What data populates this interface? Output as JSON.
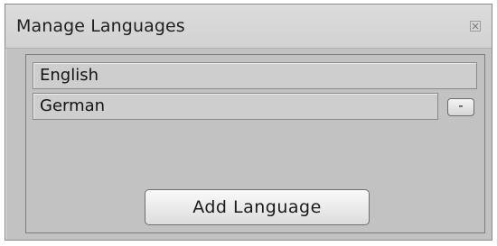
{
  "window": {
    "title": "Manage Languages",
    "close_icon": "close-icon"
  },
  "languages": [
    {
      "label": "English",
      "removable": false
    },
    {
      "label": "German",
      "removable": true,
      "remove_label": "-"
    }
  ],
  "actions": {
    "add_label": "Add Language"
  }
}
